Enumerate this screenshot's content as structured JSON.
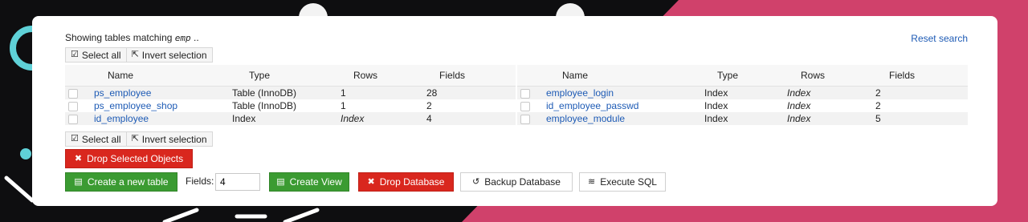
{
  "header": {
    "showing_label": "Showing tables matching",
    "query": "emp",
    "ellipsis": "..",
    "reset_label": "Reset search"
  },
  "selection": {
    "select_all": "Select all",
    "invert": "Invert selection"
  },
  "columns": [
    "Name",
    "Type",
    "Rows",
    "Fields"
  ],
  "left_table": [
    {
      "name": "ps_employee",
      "type": "Table (InnoDB)",
      "rows": "1",
      "fields": "28"
    },
    {
      "name": "ps_employee_shop",
      "type": "Table (InnoDB)",
      "rows": "1",
      "fields": "2"
    },
    {
      "name": "id_employee",
      "type": "Index",
      "rows": "Index",
      "fields": "4"
    }
  ],
  "right_table": [
    {
      "name": "employee_login",
      "type": "Index",
      "rows": "Index",
      "fields": "2"
    },
    {
      "name": "id_employee_passwd",
      "type": "Index",
      "rows": "Index",
      "fields": "2"
    },
    {
      "name": "employee_module",
      "type": "Index",
      "rows": "Index",
      "fields": "5"
    }
  ],
  "actions": {
    "drop_selected": "Drop Selected Objects",
    "create_table": "Create a new table",
    "fields_label": "Fields:",
    "fields_value": "4",
    "create_view": "Create View",
    "drop_database": "Drop Database",
    "backup_database": "Backup Database",
    "execute_sql": "Execute SQL"
  },
  "colors": {
    "accent_link": "#1e5bb5",
    "danger": "#d9271e",
    "success": "#3b9b32",
    "bg_pink": "#d0416b"
  },
  "icons": {
    "select_all": "check-square-icon",
    "invert": "share-square-icon",
    "drop": "times-circle-icon",
    "create_table": "table-plus-icon",
    "create_view": "view-plus-icon",
    "backup": "history-icon",
    "sql": "database-icon"
  }
}
